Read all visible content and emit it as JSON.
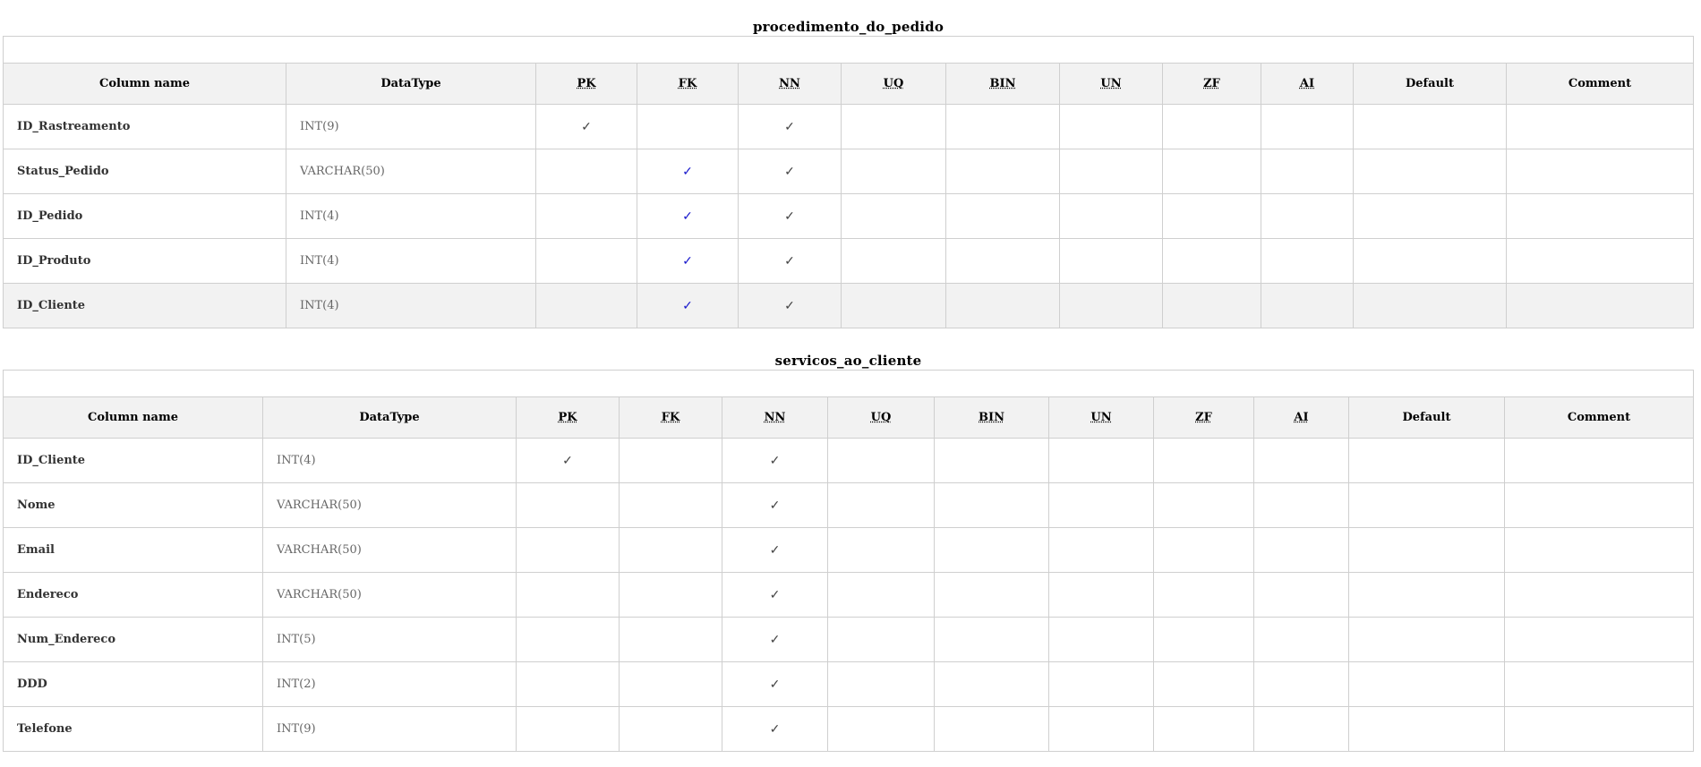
{
  "flag_headers": [
    "PK",
    "FK",
    "NN",
    "UQ",
    "BIN",
    "UN",
    "ZF",
    "AI"
  ],
  "header_labels": {
    "column_name": "Column name",
    "datatype": "DataType",
    "default": "Default",
    "comment": "Comment"
  },
  "check_glyph": "✓",
  "colors": {
    "fk_check": "#1a1acc",
    "check": "#444444",
    "header_bg": "#f2f2f2",
    "border": "#cfcfcf"
  },
  "tables": [
    {
      "name": "procedimento_do_pedido",
      "rows": [
        {
          "column": "ID_Rastreamento",
          "type": "INT(9)",
          "pk": true,
          "fk": false,
          "nn": true,
          "default": "",
          "comment": ""
        },
        {
          "column": "Status_Pedido",
          "type": "VARCHAR(50)",
          "pk": false,
          "fk": true,
          "nn": true,
          "default": "",
          "comment": ""
        },
        {
          "column": "ID_Pedido",
          "type": "INT(4)",
          "pk": false,
          "fk": true,
          "nn": true,
          "default": "",
          "comment": ""
        },
        {
          "column": "ID_Produto",
          "type": "INT(4)",
          "pk": false,
          "fk": true,
          "nn": true,
          "default": "",
          "comment": ""
        },
        {
          "column": "ID_Cliente",
          "type": "INT(4)",
          "pk": false,
          "fk": true,
          "nn": true,
          "default": "",
          "comment": ""
        }
      ]
    },
    {
      "name": "servicos_ao_cliente",
      "rows": [
        {
          "column": "ID_Cliente",
          "type": "INT(4)",
          "pk": true,
          "fk": false,
          "nn": true,
          "default": "",
          "comment": ""
        },
        {
          "column": "Nome",
          "type": "VARCHAR(50)",
          "pk": false,
          "fk": false,
          "nn": true,
          "default": "",
          "comment": ""
        },
        {
          "column": "Email",
          "type": "VARCHAR(50)",
          "pk": false,
          "fk": false,
          "nn": true,
          "default": "",
          "comment": ""
        },
        {
          "column": "Endereco",
          "type": "VARCHAR(50)",
          "pk": false,
          "fk": false,
          "nn": true,
          "default": "",
          "comment": ""
        },
        {
          "column": "Num_Endereco",
          "type": "INT(5)",
          "pk": false,
          "fk": false,
          "nn": true,
          "default": "",
          "comment": ""
        },
        {
          "column": "DDD",
          "type": "INT(2)",
          "pk": false,
          "fk": false,
          "nn": true,
          "default": "",
          "comment": ""
        },
        {
          "column": "Telefone",
          "type": "INT(9)",
          "pk": false,
          "fk": false,
          "nn": true,
          "default": "",
          "comment": ""
        }
      ]
    }
  ]
}
